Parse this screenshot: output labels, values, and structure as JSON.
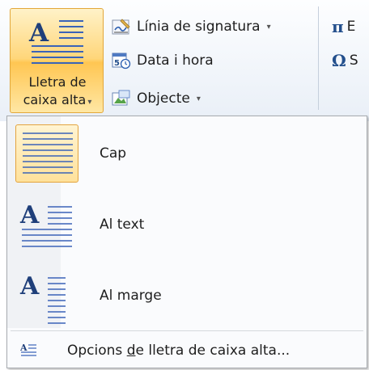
{
  "ribbon": {
    "dropcap_button": {
      "line1": "Lletra de",
      "line2": "caixa alta"
    },
    "commands": [
      {
        "label": "Línia de signatura",
        "icon": "signature-line-icon",
        "has_dropdown": true
      },
      {
        "label": "Data i hora",
        "icon": "date-time-icon",
        "has_dropdown": false
      },
      {
        "label": "Objecte",
        "icon": "object-icon",
        "has_dropdown": true
      }
    ],
    "symbols": [
      {
        "glyph": "π",
        "label": "E",
        "icon": "equation-icon"
      },
      {
        "glyph": "Ω",
        "label": "S",
        "icon": "symbol-icon"
      }
    ],
    "caret": "▾"
  },
  "menu": {
    "items": [
      {
        "label": "Cap",
        "icon": "no-dropcap-icon",
        "selected": true
      },
      {
        "label": "Al text",
        "icon": "dropped-dropcap-icon",
        "selected": false
      },
      {
        "label": "Al marge",
        "icon": "in-margin-dropcap-icon",
        "selected": false
      }
    ],
    "options": {
      "prefix": "Opcions ",
      "mnemonic": "d",
      "suffix": "e lletra de caixa alta...",
      "icon": "dropcap-options-icon"
    }
  },
  "colors": {
    "accent_border": "#e3a33d",
    "accent_fill": "#ffe19b",
    "icon_blue": "#234f8c"
  }
}
